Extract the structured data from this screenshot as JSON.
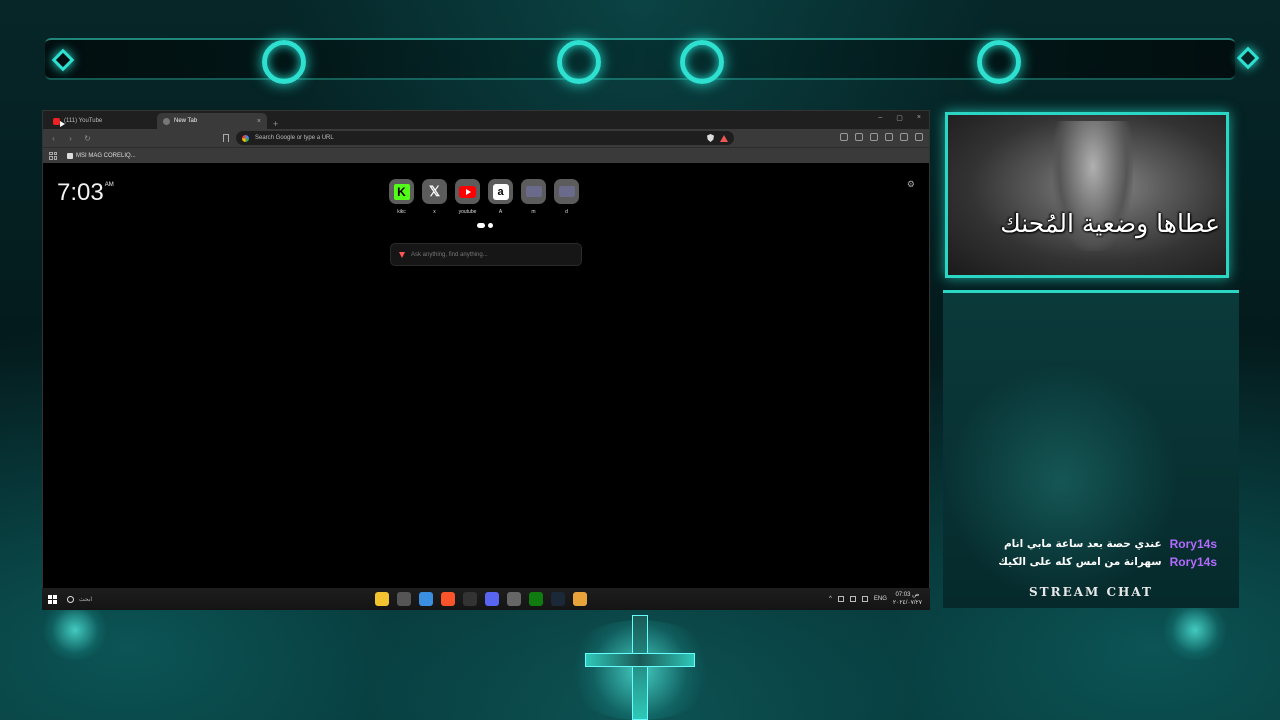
{
  "browser": {
    "tabs": [
      {
        "label": "(111) YouTube",
        "icon": "youtube-icon",
        "active": false
      },
      {
        "label": "New Tab",
        "icon": "new-tab-icon",
        "active": true
      }
    ],
    "new_tab_symbol": "+",
    "tab_close_symbol": "×",
    "window_controls": {
      "minimize": "–",
      "restore": "▢",
      "close": "×"
    },
    "omnibox_placeholder": "Search Google or type a URL",
    "bookmark_item": "MSI MAG CORELIQ...",
    "clock": {
      "time": "7:03",
      "suffix": "AM"
    },
    "shortcuts": [
      {
        "label": "kikc",
        "icon": "kick-icon"
      },
      {
        "label": "x",
        "icon": "x-icon"
      },
      {
        "label": "youtube",
        "icon": "youtube-icon"
      },
      {
        "label": "A",
        "icon": "amazon-icon"
      },
      {
        "label": "m",
        "icon": "mail-icon"
      },
      {
        "label": "d",
        "icon": "mail-icon"
      }
    ],
    "ask_placeholder": "Ask anything, find anything..."
  },
  "taskbar": {
    "search_placeholder": "ابحث",
    "apps": [
      {
        "name": "file-explorer-icon",
        "color": "#f2c230"
      },
      {
        "name": "calculator-icon",
        "color": "#555555"
      },
      {
        "name": "store-icon",
        "color": "#3a8fe0"
      },
      {
        "name": "brave-icon",
        "color": "#fb542b"
      },
      {
        "name": "obs-icon",
        "color": "#333333"
      },
      {
        "name": "discord-icon",
        "color": "#5865f2"
      },
      {
        "name": "settings-icon",
        "color": "#666666"
      },
      {
        "name": "xbox-icon",
        "color": "#107c10"
      },
      {
        "name": "steam-icon",
        "color": "#1b2838"
      },
      {
        "name": "chrome-icon",
        "color": "#e8a33a"
      }
    ],
    "tray_lang": "ENG",
    "tray_time": "07:03 ص",
    "tray_date": "٢٠٢٤/٠٧/٢٧"
  },
  "webcam": {
    "caption": "عطاها وضعية المُحنك"
  },
  "chat": {
    "title": "STREAM CHAT",
    "messages": [
      {
        "user": "Rory14s",
        "text": "عندي حصة بعد ساعة مابي انام"
      },
      {
        "user": "Rory14s",
        "text": "سهرانة من امس كله على الكيك"
      }
    ]
  },
  "colors": {
    "accent": "#2bd6c4",
    "chat_username": "#b36bff",
    "kick_green": "#53fc18",
    "youtube_red": "#ff0000"
  }
}
